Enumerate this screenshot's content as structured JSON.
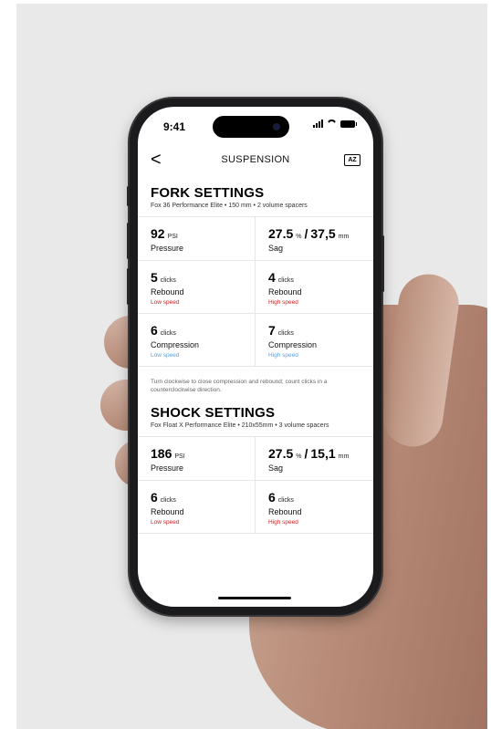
{
  "status": {
    "time": "9:41"
  },
  "nav": {
    "back_label": "<",
    "title": "SUSPENSION",
    "manual_icon": "AZ"
  },
  "fork": {
    "title": "FORK SETTINGS",
    "subtitle": "Fox 36 Performance Elite • 150 mm • 2 volume spacers",
    "pressure": {
      "value": "92",
      "unit": "PSI",
      "label": "Pressure"
    },
    "sag": {
      "value1": "27.5",
      "unit1": "%",
      "sep": "/",
      "value2": "37,5",
      "unit2": "mm",
      "label": "Sag"
    },
    "rebound_low": {
      "value": "5",
      "unit": "clicks",
      "label": "Rebound",
      "sub": "Low speed"
    },
    "rebound_high": {
      "value": "4",
      "unit": "clicks",
      "label": "Rebound",
      "sub": "High speed"
    },
    "compression_low": {
      "value": "6",
      "unit": "clicks",
      "label": "Compression",
      "sub": "Low speed"
    },
    "compression_high": {
      "value": "7",
      "unit": "clicks",
      "label": "Compression",
      "sub": "High speed"
    },
    "note": "Turn clockwise to close compression and rebound; count clicks in a counterclockwise direction."
  },
  "shock": {
    "title": "SHOCK SETTINGS",
    "subtitle": "Fox Float X Performance Elite • 210x55mm • 3 volume spacers",
    "pressure": {
      "value": "186",
      "unit": "PSI",
      "label": "Pressure"
    },
    "sag": {
      "value1": "27.5",
      "unit1": "%",
      "sep": "/",
      "value2": "15,1",
      "unit2": "mm",
      "label": "Sag"
    },
    "rebound_low": {
      "value": "6",
      "unit": "clicks",
      "label": "Rebound",
      "sub": "Low speed"
    },
    "rebound_high": {
      "value": "6",
      "unit": "clicks",
      "label": "Rebound",
      "sub": "High speed"
    }
  },
  "colors": {
    "low_rebound": "#d41e1e",
    "high_rebound": "#d41e1e",
    "compression": "#5a9fdc"
  }
}
